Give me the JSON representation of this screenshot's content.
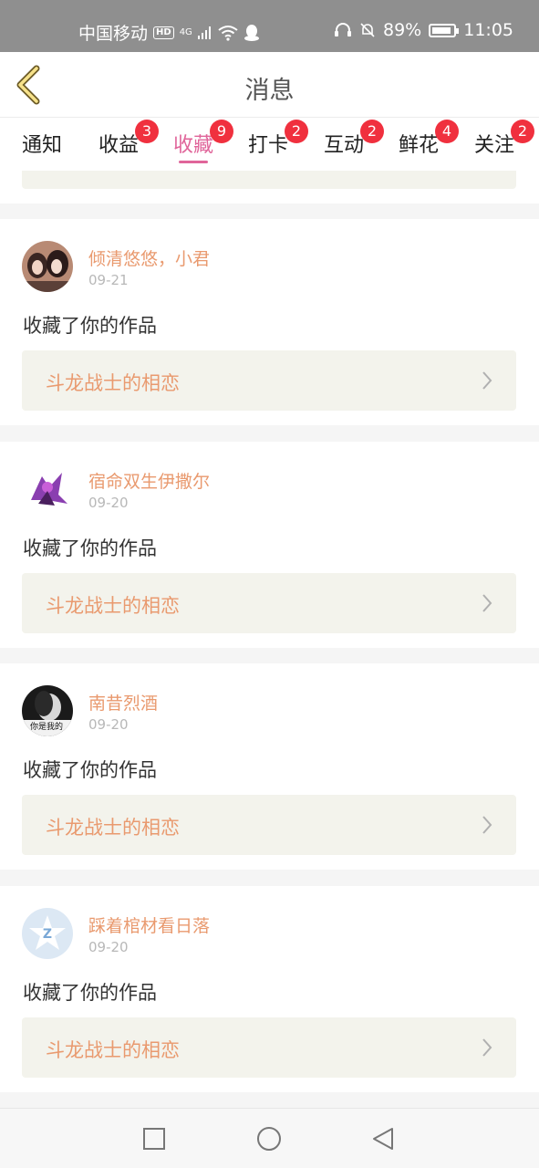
{
  "status_bar": {
    "carrier": "中国移动",
    "hd_label": "HD",
    "network": "4G",
    "battery": "89%",
    "battery_level": 0.89,
    "time": "11:05"
  },
  "header": {
    "title": "消息",
    "back_icon": "chevron-left-icon"
  },
  "tabs": [
    {
      "label": "通知",
      "badge": ""
    },
    {
      "label": "收益",
      "badge": "3"
    },
    {
      "label": "收藏",
      "badge": "9",
      "active": true
    },
    {
      "label": "打卡",
      "badge": "2"
    },
    {
      "label": "互动",
      "badge": "2"
    },
    {
      "label": "鲜花",
      "badge": "4"
    },
    {
      "label": "关注",
      "badge": "2"
    }
  ],
  "items": [
    {
      "user": "倾清悠悠，小君",
      "date": "09-21",
      "action": "收藏了你的作品",
      "work": "斗龙战士的相恋"
    },
    {
      "user": "宿命双生伊撒尔",
      "date": "09-20",
      "action": "收藏了你的作品",
      "work": "斗龙战士的相恋"
    },
    {
      "user": "南昔烈酒",
      "date": "09-20",
      "action": "收藏了你的作品",
      "work": "斗龙战士的相恋",
      "avatar_text": "你是我的"
    },
    {
      "user": "踩着棺材看日落",
      "date": "09-20",
      "action": "收藏了你的作品",
      "work": "斗龙战士的相恋"
    }
  ],
  "colors": {
    "accent": "#e0659a",
    "username": "#e99a6f",
    "badge": "#f0303e",
    "card_box": "#f3f3ec"
  },
  "nav": [
    "square-icon",
    "circle-icon",
    "triangle-back-icon"
  ]
}
